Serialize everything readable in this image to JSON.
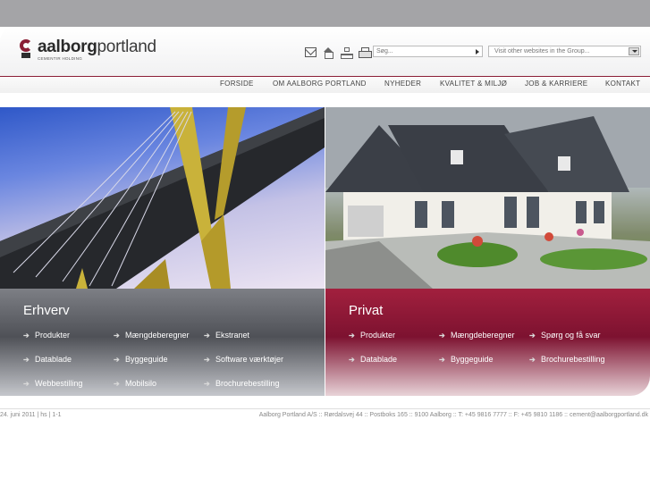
{
  "brand": {
    "name_bold": "aalborg",
    "name_light": "portland",
    "tagline": "CEMENTIR HOLDING",
    "accent_color": "#8a1e36"
  },
  "toolbar": {
    "icons": [
      "mail-icon",
      "home-icon",
      "sitemap-icon",
      "print-icon"
    ],
    "search_placeholder": "Søg...",
    "group_select": "Visit other websites in the Group..."
  },
  "nav": {
    "items": [
      "FORSIDE",
      "OM AALBORG PORTLAND",
      "NYHEDER",
      "KVALITET & MILJØ",
      "JOB & KARRIERE",
      "KONTAKT"
    ]
  },
  "panels": {
    "erhverv": {
      "title": "Erhverv",
      "links": [
        "Produkter",
        "Mængdeberegner",
        "Ekstranet",
        "Datablade",
        "Byggeguide",
        "Software værktøjer",
        "Webbestilling",
        "Mobilsilo",
        "Brochurebestilling"
      ]
    },
    "privat": {
      "title": "Privat",
      "links": [
        "Produkter",
        "Mængdeberegner",
        "Spørg og få svar",
        "Datablade",
        "Byggeguide",
        "Brochurebestilling"
      ]
    }
  },
  "footer": {
    "left": "24. juni 2011 | hs | 1-1",
    "right": "Aalborg Portland A/S :: Rørdalsvej 44 :: Postboks 165 :: 9100 Aalborg :: T: +45 9816 7777 :: F: +45 9810 1186 :: cement@aalborgportland.dk"
  }
}
